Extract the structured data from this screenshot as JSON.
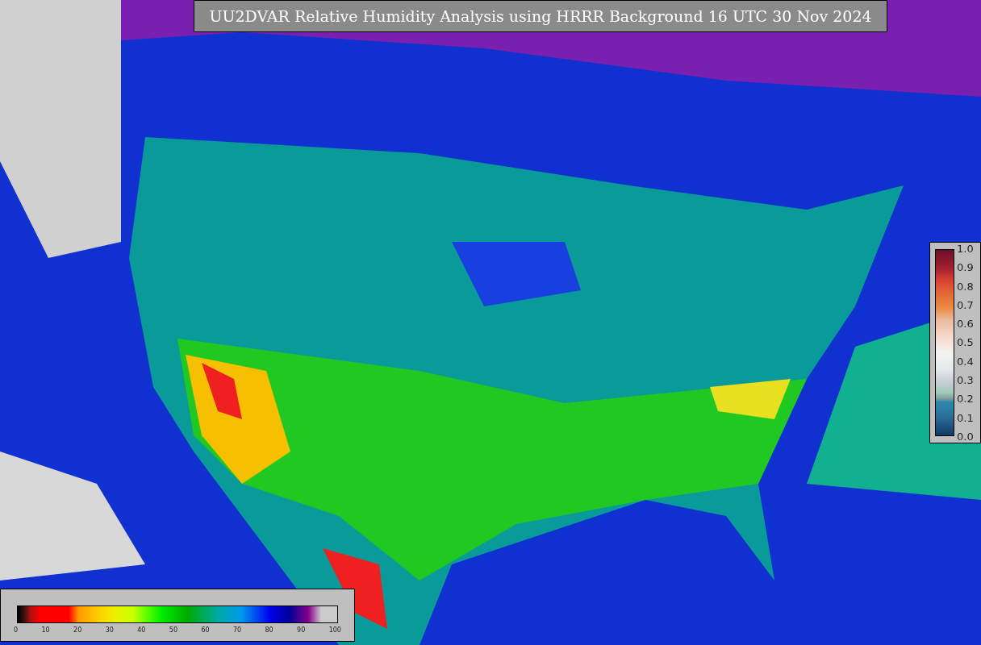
{
  "title": "UU2DVAR Relative Humidity Analysis using HRRR Background 16 UTC 30 Nov 2024",
  "humidity_legend": {
    "ticks": [
      "0",
      "10",
      "20",
      "30",
      "40",
      "50",
      "60",
      "70",
      "80",
      "90",
      "100"
    ]
  },
  "ratio_legend": {
    "ticks": [
      "1.0",
      "0.9",
      "0.8",
      "0.7",
      "0.6",
      "0.5",
      "0.4",
      "0.3",
      "0.2",
      "0.1",
      "0.0"
    ]
  }
}
